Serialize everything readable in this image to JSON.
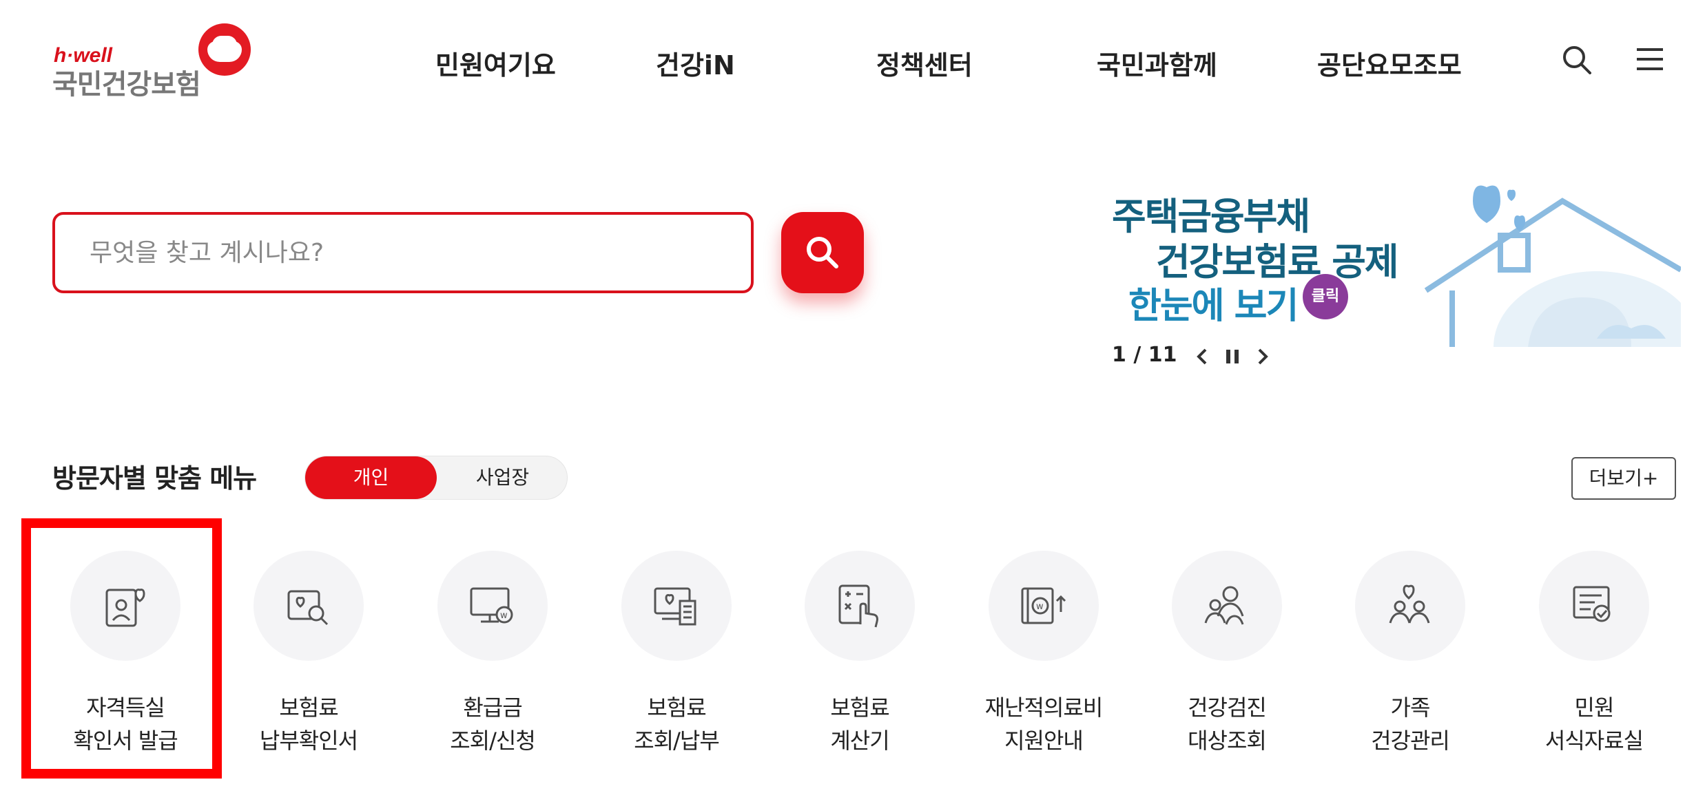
{
  "header": {
    "logo_hwell": "h·well",
    "logo_name": "국민건강보험",
    "nav": [
      "민원여기요",
      "건강iN",
      "정책센터",
      "국민과함께",
      "공단요모조모"
    ]
  },
  "search": {
    "placeholder": "무엇을 찾고 계시나요?"
  },
  "banner": {
    "line1": "주택금융부채",
    "line2": "건강보험료 공제",
    "line3": "한눈에 보기",
    "badge": "클릭",
    "counter": "1 / 11"
  },
  "custom_menu": {
    "title": "방문자별 맞춤 메뉴",
    "toggle_active": "개인",
    "toggle_inactive": "사업장",
    "more_label": "더보기+",
    "items": [
      {
        "line1": "자격득실",
        "line2": "확인서 발급",
        "icon": "person-card-heart-icon"
      },
      {
        "line1": "보험료",
        "line2": "납부확인서",
        "icon": "heart-doc-search-icon"
      },
      {
        "line1": "환급금",
        "line2": "조회/신청",
        "icon": "monitor-won-icon"
      },
      {
        "line1": "보험료",
        "line2": "조회/납부",
        "icon": "monitor-heart-receipt-icon"
      },
      {
        "line1": "보험료",
        "line2": "계산기",
        "icon": "calculator-hand-icon"
      },
      {
        "line1": "재난적의료비",
        "line2": "지원안내",
        "icon": "book-won-up-icon"
      },
      {
        "line1": "건강검진",
        "line2": "대상조회",
        "icon": "person-group-icon"
      },
      {
        "line1": "가족",
        "line2": "건강관리",
        "icon": "family-heart-icon"
      },
      {
        "line1": "민원",
        "line2": "서식자료실",
        "icon": "document-check-icon"
      }
    ]
  },
  "colors": {
    "brand_red": "#e41019",
    "highlight": "#ff0000",
    "banner_navy": "#14607e",
    "banner_blue": "#1c87b8"
  }
}
